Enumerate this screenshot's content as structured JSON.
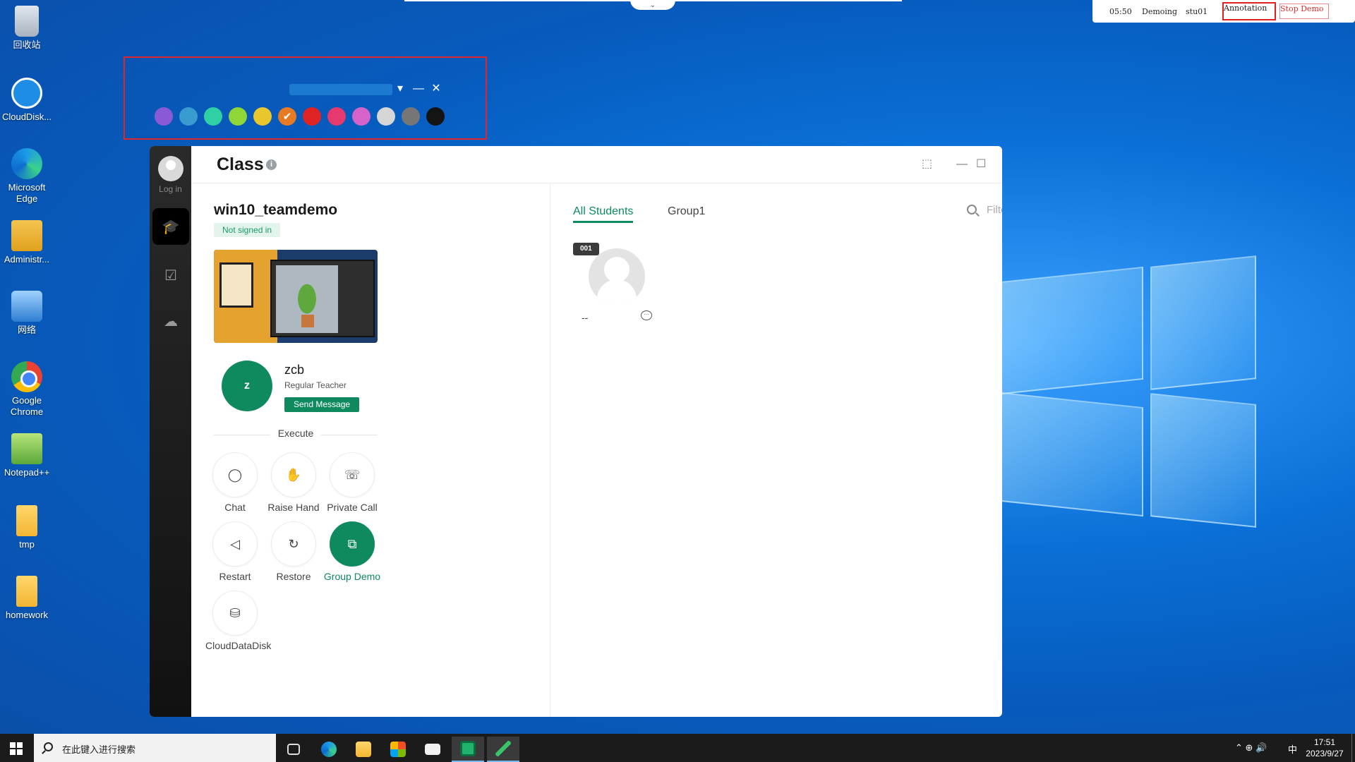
{
  "desktop": {
    "icons": [
      {
        "label": "回收站",
        "icon": "recycle-bin-icon"
      },
      {
        "label": "CloudDisk...",
        "icon": "cloud-disk-icon"
      },
      {
        "label": "Microsoft Edge",
        "icon": "edge-icon"
      },
      {
        "label": "Administr...",
        "icon": "user-folder-icon"
      },
      {
        "label": "网络",
        "icon": "network-icon"
      },
      {
        "label": "Google Chrome",
        "icon": "chrome-icon"
      },
      {
        "label": "Notepad++",
        "icon": "notepadpp-icon"
      },
      {
        "label": "tmp",
        "icon": "folder-icon"
      },
      {
        "label": "homework",
        "icon": "folder-icon"
      }
    ]
  },
  "demo_bar": {
    "time": "05:50",
    "status": "Demoing",
    "user": "stu01",
    "annotation_label": "Annotation",
    "stop_label": "Stop Demo"
  },
  "palette": {
    "colors": [
      "#8a5ad6",
      "#3a9bd1",
      "#2fd0a4",
      "#8fd637",
      "#e9c62c",
      "#e77b23",
      "#e02424",
      "#e63a6e",
      "#d563c9",
      "#d6d6d6",
      "#767676",
      "#141414"
    ],
    "selected_index": 5,
    "check_glyph": "✔",
    "minimize_glyph": "—",
    "close_glyph": "✕",
    "dropdown_glyph": "▾"
  },
  "app": {
    "rail": {
      "login_label": "Log in",
      "items": [
        {
          "icon": "graduation-cap-icon",
          "glyph": "🎓",
          "active": true
        },
        {
          "icon": "task-check-icon",
          "glyph": "☑",
          "active": false
        },
        {
          "icon": "cloud-upload-icon",
          "glyph": "☁",
          "active": false
        }
      ]
    },
    "header": {
      "title": "Class",
      "info_glyph": "i",
      "chat_glyph": "⬚",
      "minimize_glyph": "—",
      "maximize_glyph": "☐"
    },
    "side": {
      "class_name": "win10_teamdemo",
      "sign_status": "Not signed in",
      "teacher": {
        "initial": "z",
        "name": "zcb",
        "role": "Regular Teacher",
        "send_label": "Send Message"
      },
      "execute_label": "Execute",
      "actions": [
        {
          "label": "Chat",
          "glyph": "◯",
          "icon": "chat-icon"
        },
        {
          "label": "Raise Hand",
          "glyph": "✋",
          "icon": "raise-hand-icon"
        },
        {
          "label": "Private Call",
          "glyph": "☏",
          "icon": "phone-icon"
        },
        {
          "label": "Restart",
          "glyph": "◁",
          "icon": "restart-icon"
        },
        {
          "label": "Restore",
          "glyph": "↻",
          "icon": "restore-icon"
        },
        {
          "label": "Group Demo",
          "glyph": "⧉",
          "icon": "group-demo-icon",
          "active": true
        },
        {
          "label": "CloudDataDisk",
          "glyph": "⛁",
          "icon": "disk-icon"
        }
      ]
    },
    "main": {
      "tabs": [
        {
          "label": "All Students",
          "active": true
        },
        {
          "label": "Group1",
          "active": false
        }
      ],
      "filter_placeholder": "Filter",
      "students": [
        {
          "number": "001",
          "name": "--"
        }
      ]
    }
  },
  "taskbar": {
    "search_placeholder": "在此键入进行搜索",
    "ime": "中",
    "time": "17:51",
    "date": "2023/9/27",
    "tray_glyphs": "⌃  ⊕  🔊"
  }
}
